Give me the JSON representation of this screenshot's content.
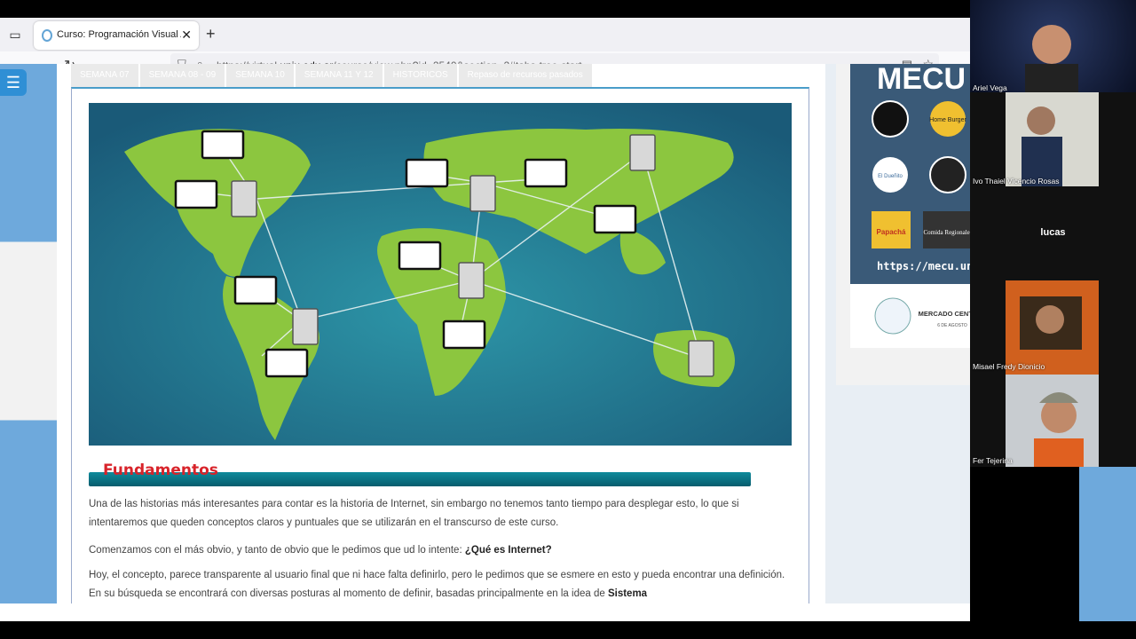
{
  "browser": {
    "tab_title": "Curso: Programación Visual API",
    "tab_close": "✕",
    "new_tab": "+",
    "url_prefix": "https://virtual.",
    "url_domain": "unju.edu.ar",
    "url_suffix": "/course/view.php?id=2540&section=2#tabs-tree-start"
  },
  "course": {
    "week_tabs": [
      "SEMANA 07",
      "SEMANA 08 - 09",
      "SEMANA 10",
      "SEMANA 11 Y 12",
      "HISTORICOS",
      "Repaso de recursos pasados"
    ],
    "section_heading": "Fundamentos",
    "paragraphs": [
      {
        "text": "Una de las historias más interesantes para contar es la historia de Internet, sin embargo no tenemos tanto tiempo para desplegar esto, lo que si intentaremos que queden conceptos claros y puntuales que se utilizarán en el transcurso de este curso.",
        "bold": ""
      },
      {
        "text": "Comenzamos con el más obvio, y tanto de obvio que le pedimos que ud lo intente: ",
        "bold": "¿Qué es Internet?"
      },
      {
        "text": "Hoy, el concepto, parece transparente al usuario final que ni hace falta definirlo, pero le pedimos que se esmere en esto y pueda encontrar una definición. En su búsqueda se encontrará con diversas posturas al momento de definir, basadas principalmente en la idea de ",
        "bold": "Sistema"
      }
    ]
  },
  "ad": {
    "title": "MECU",
    "url": "https://mecu.un",
    "logos": [
      "Home Burger",
      "El Dueñito",
      "Papachá",
      "Comida Regionales"
    ],
    "footer_logo": "MERCADO CENTRAL",
    "footer_sub": "6 DE AGOSTO"
  },
  "participants": [
    {
      "name": "Ariel Vega"
    },
    {
      "name": "Ivo Thaiel Vicencio Rosas"
    },
    {
      "name": "lucas"
    },
    {
      "name": "Misael Fredy Dionicio"
    },
    {
      "name": "Fer Tejerina"
    }
  ],
  "colors": {
    "accent": "#2f8fd5",
    "heading_red": "#d8232a",
    "map_ocean": "#1a6f8a",
    "map_land": "#8cc63f"
  }
}
